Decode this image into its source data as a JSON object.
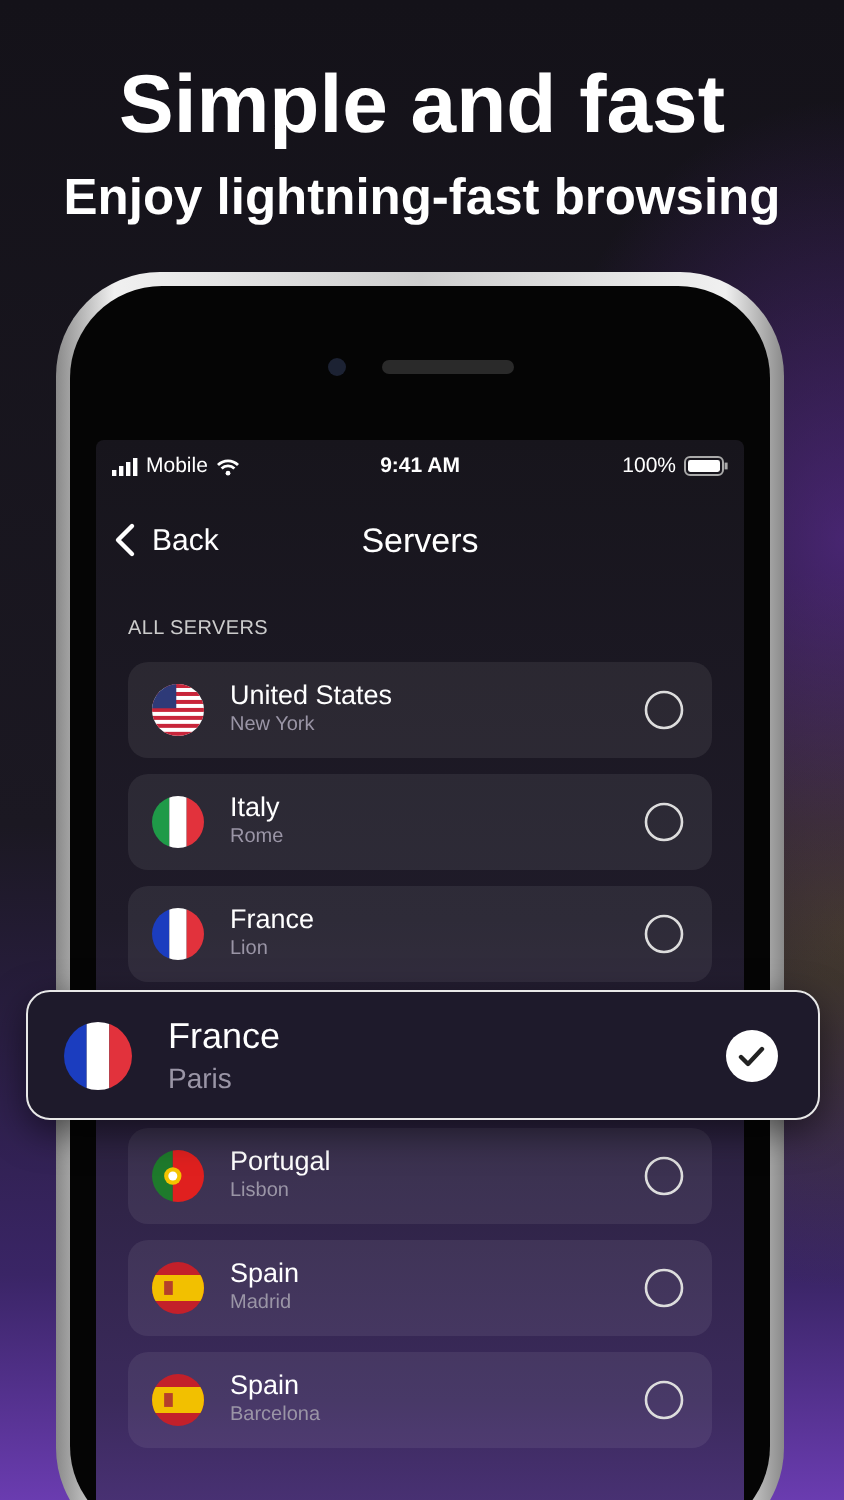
{
  "headline": "Simple and fast",
  "subheadline": "Enjoy lightning-fast browsing",
  "status_bar": {
    "carrier": "Mobile",
    "time": "9:41 AM",
    "battery": "100%"
  },
  "nav": {
    "back": "Back",
    "title": "Servers"
  },
  "section": "ALL SERVERS",
  "servers": [
    {
      "country": "United States",
      "city": "New York",
      "kind": "us",
      "selected": false
    },
    {
      "country": "Italy",
      "city": "Rome",
      "kind": "it",
      "selected": false
    },
    {
      "country": "France",
      "city": "Lion",
      "kind": "fr",
      "selected": false
    },
    {
      "country": "France",
      "city": "Paris",
      "kind": "fr",
      "selected": true
    },
    {
      "country": "Portugal",
      "city": "Lisbon",
      "kind": "pt",
      "selected": false
    },
    {
      "country": "Spain",
      "city": "Madrid",
      "kind": "es",
      "selected": false
    },
    {
      "country": "Spain",
      "city": "Barcelona",
      "kind": "es",
      "selected": false
    }
  ]
}
